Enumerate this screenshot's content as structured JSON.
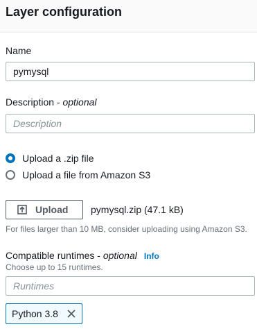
{
  "header": {
    "title": "Layer configuration"
  },
  "name_field": {
    "label": "Name",
    "value": "pymysql"
  },
  "description_field": {
    "label": "Description - ",
    "optional": "optional",
    "placeholder": "Description"
  },
  "source": {
    "options": [
      {
        "label": "Upload a .zip file",
        "selected": true
      },
      {
        "label": "Upload a file from Amazon S3",
        "selected": false
      }
    ]
  },
  "upload": {
    "button_label": "Upload",
    "file_info": "pymysql.zip (47.1 kB)",
    "hint": "For files larger than 10 MB, consider uploading using Amazon S3."
  },
  "runtimes": {
    "label": "Compatible runtimes - ",
    "optional": "optional",
    "info_link": "Info",
    "hint": "Choose up to 15 runtimes.",
    "placeholder": "Runtimes",
    "selected": [
      "Python 3.8"
    ]
  },
  "colors": {
    "accent": "#0073bb",
    "text": "#16191f",
    "muted": "#687078",
    "border": "#aab7b8"
  }
}
